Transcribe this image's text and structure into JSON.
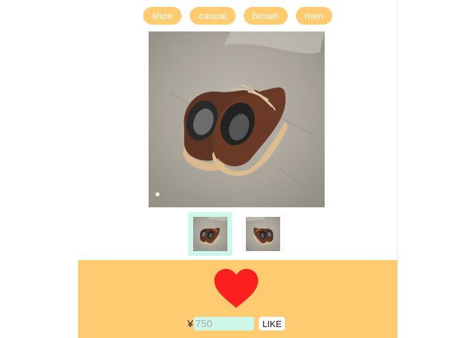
{
  "tags": [
    "shoe",
    "casual",
    "brown",
    "men"
  ],
  "photo": {
    "icon": "brown-leather-shoes-photo"
  },
  "thumbnails": [
    {
      "icon": "shoes-thumbnail",
      "selected": true
    },
    {
      "icon": "shoes-thumbnail",
      "selected": false
    }
  ],
  "bottom": {
    "heart_icon": "heart-icon",
    "currency": "¥",
    "price_placeholder": "750",
    "like_label": "LIKE"
  },
  "colors": {
    "accent": "#ffcb70",
    "heart": "#fc1f1f",
    "input_bg": "#cdf7ea",
    "tag_text": "#ffffff"
  }
}
